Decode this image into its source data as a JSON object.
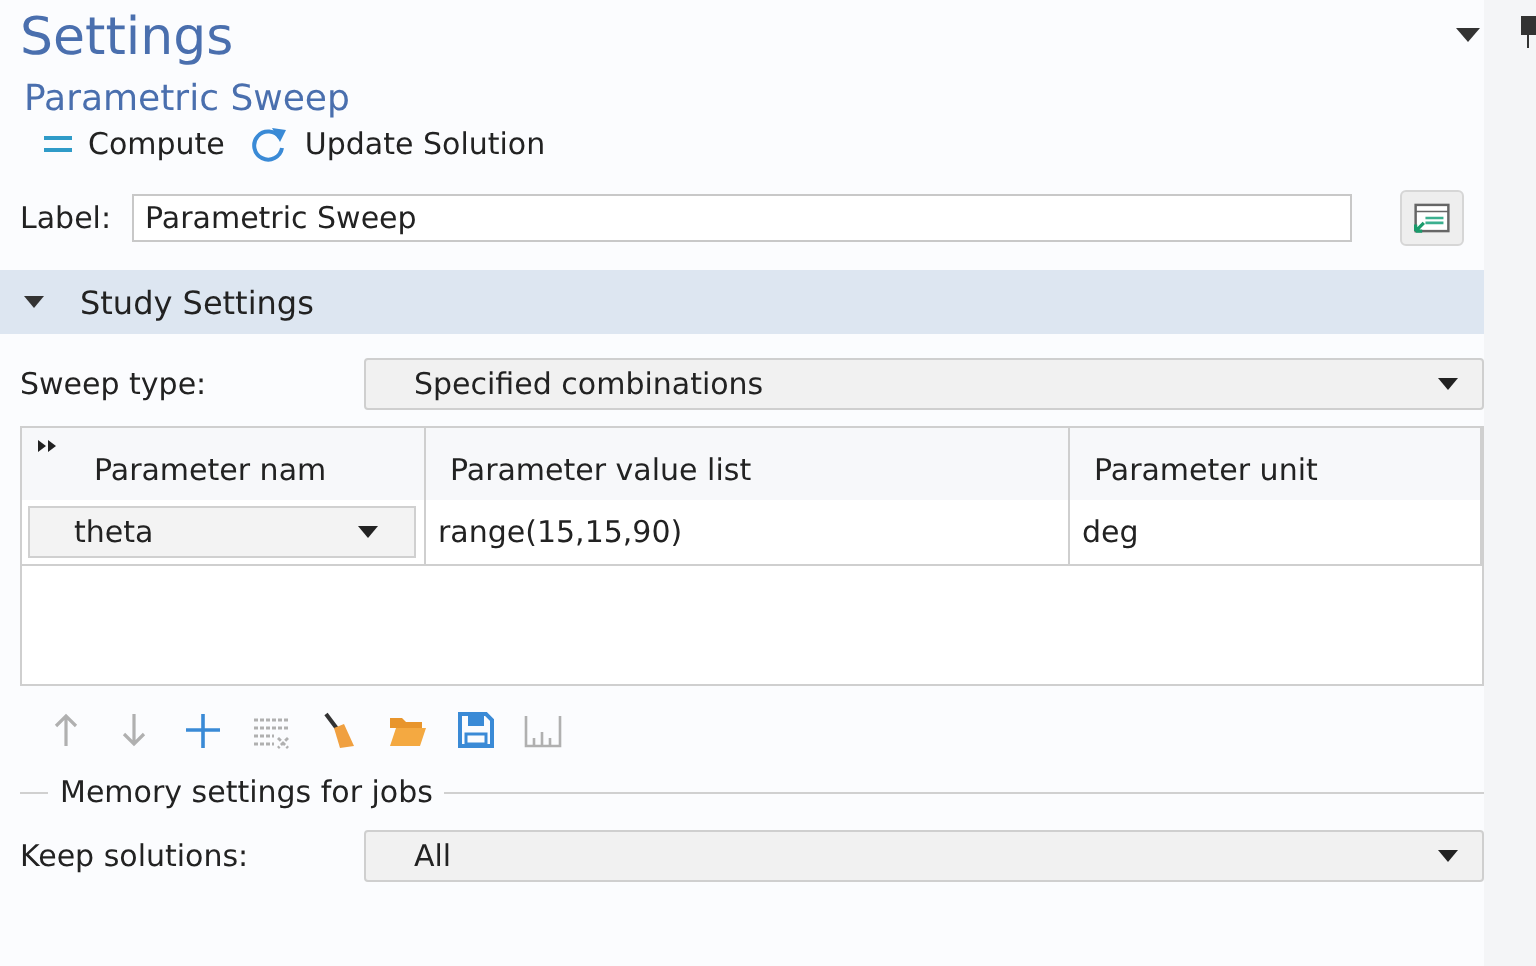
{
  "header": {
    "title": "Settings",
    "subtitle": "Parametric Sweep"
  },
  "actions": [
    {
      "kind": "compute",
      "label": "Compute"
    },
    {
      "kind": "update",
      "label": "Update Solution"
    }
  ],
  "label_field": {
    "label": "Label:",
    "value": "Parametric Sweep"
  },
  "section": {
    "title": "Study Settings",
    "expanded": true
  },
  "sweep_type": {
    "label": "Sweep type:",
    "value": "Specified combinations"
  },
  "table": {
    "columns": [
      "Parameter nam",
      "Parameter value list",
      "Parameter unit"
    ],
    "rows": [
      {
        "name": "theta",
        "values": "range(15,15,90)",
        "unit": "deg"
      }
    ]
  },
  "table_tools": [
    {
      "kind": "up",
      "disabled": true
    },
    {
      "kind": "down",
      "disabled": true
    },
    {
      "kind": "add",
      "disabled": false
    },
    {
      "kind": "delete",
      "disabled": true
    },
    {
      "kind": "clear",
      "disabled": false
    },
    {
      "kind": "open",
      "disabled": false
    },
    {
      "kind": "save",
      "disabled": false
    },
    {
      "kind": "units",
      "disabled": true
    }
  ],
  "memory": {
    "legend": "Memory settings for jobs",
    "label": "Keep solutions:",
    "value": "All"
  }
}
